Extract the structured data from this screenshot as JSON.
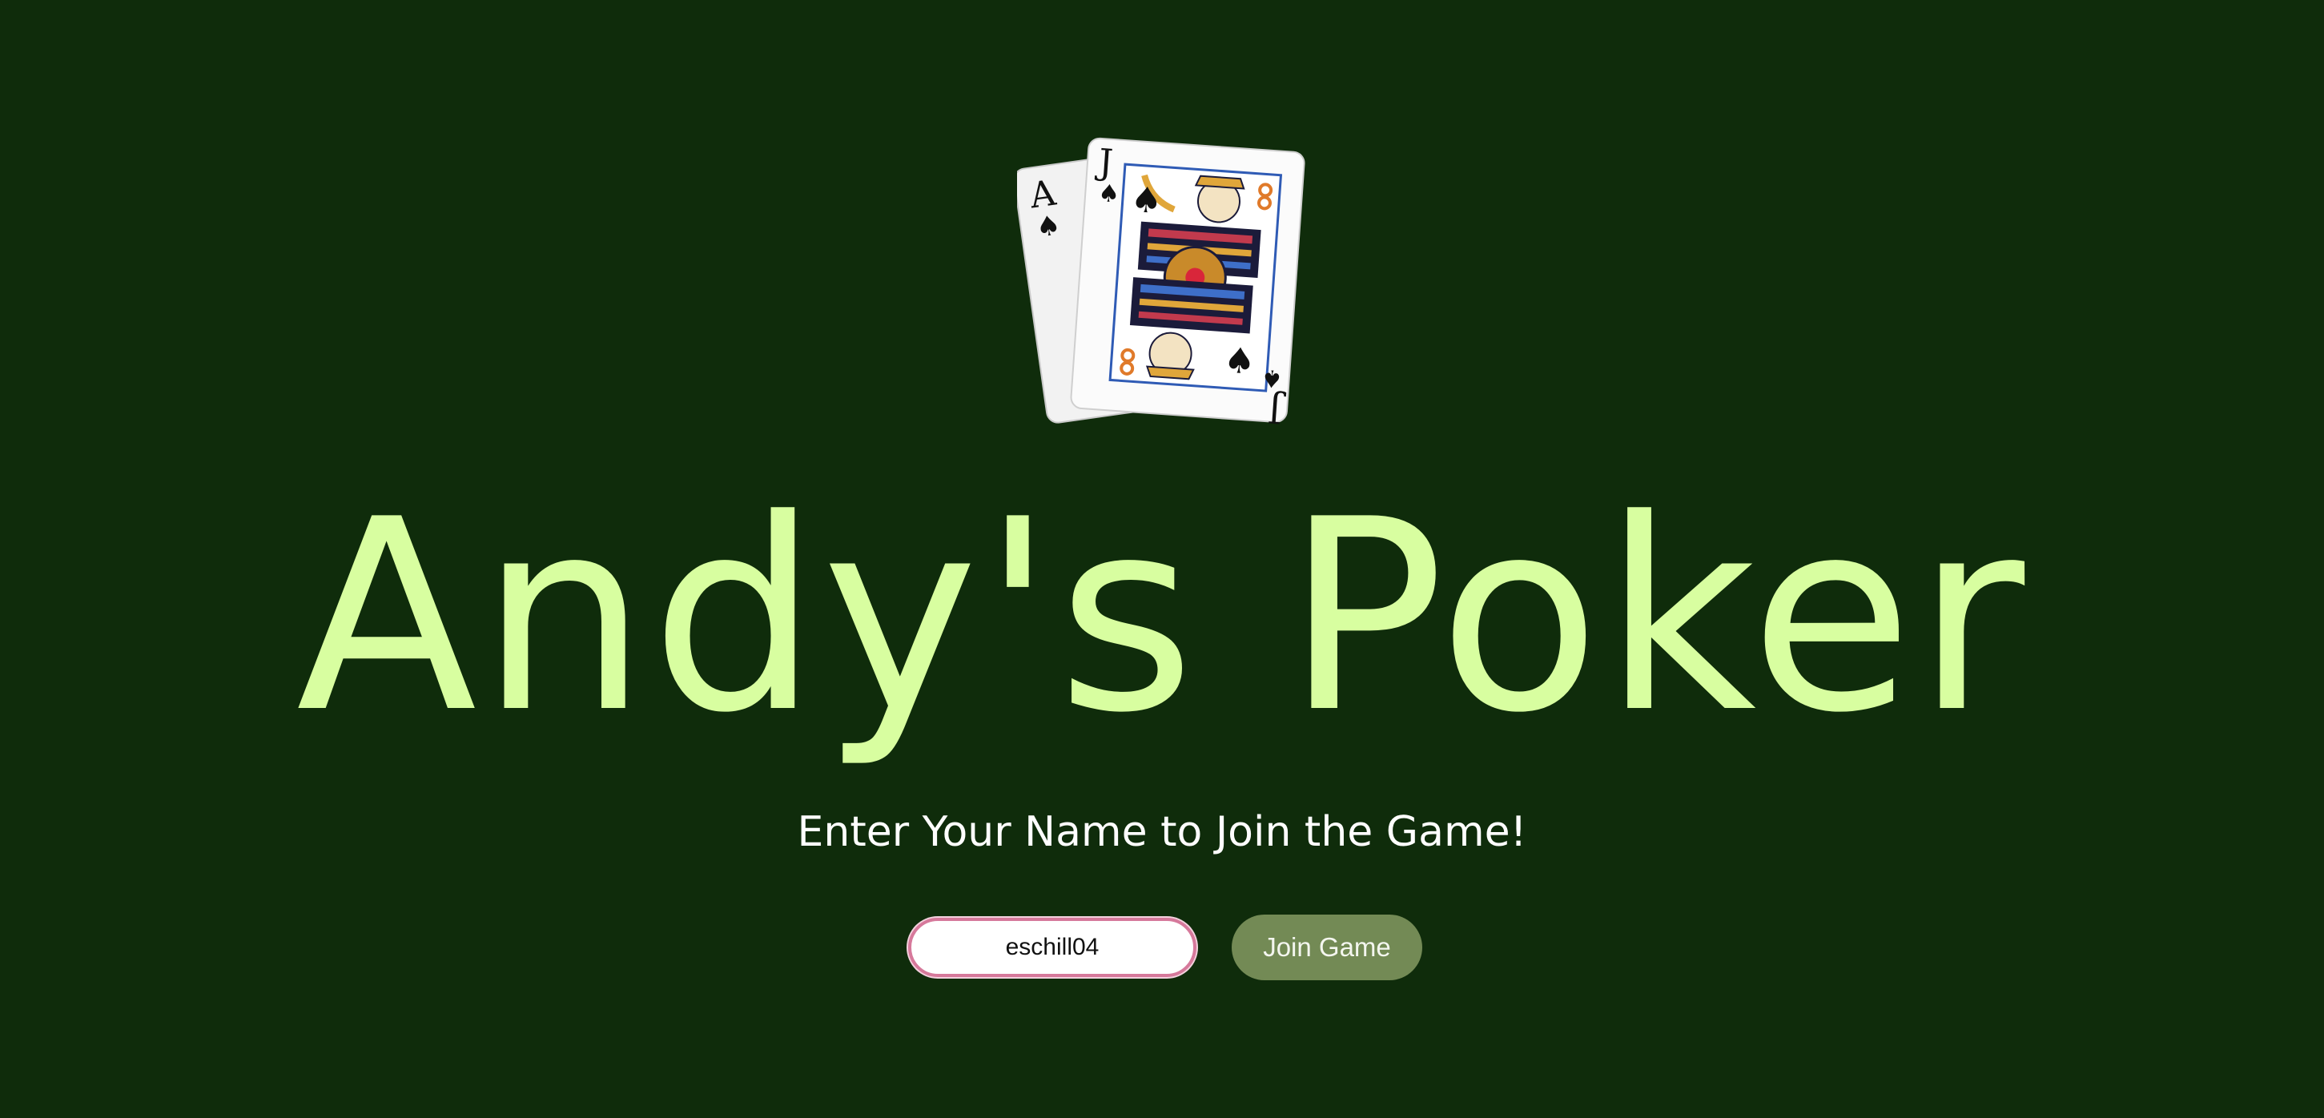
{
  "logo": {
    "icon": "playing-cards-ace-jack-of-spades-icon",
    "ace_rank": "A",
    "jack_rank": "J",
    "suit": "♠"
  },
  "title": "Andy's Poker",
  "subtitle": "Enter Your Name to Join the Game!",
  "name_input": {
    "value": "eschill04",
    "placeholder": ""
  },
  "join_button": {
    "label": "Join Game"
  },
  "colors": {
    "background": "#0f2c0b",
    "title": "#d8fea0",
    "subtitle": "#ffffff",
    "button": "#738a55",
    "input_focus_border": "#d6799b"
  }
}
